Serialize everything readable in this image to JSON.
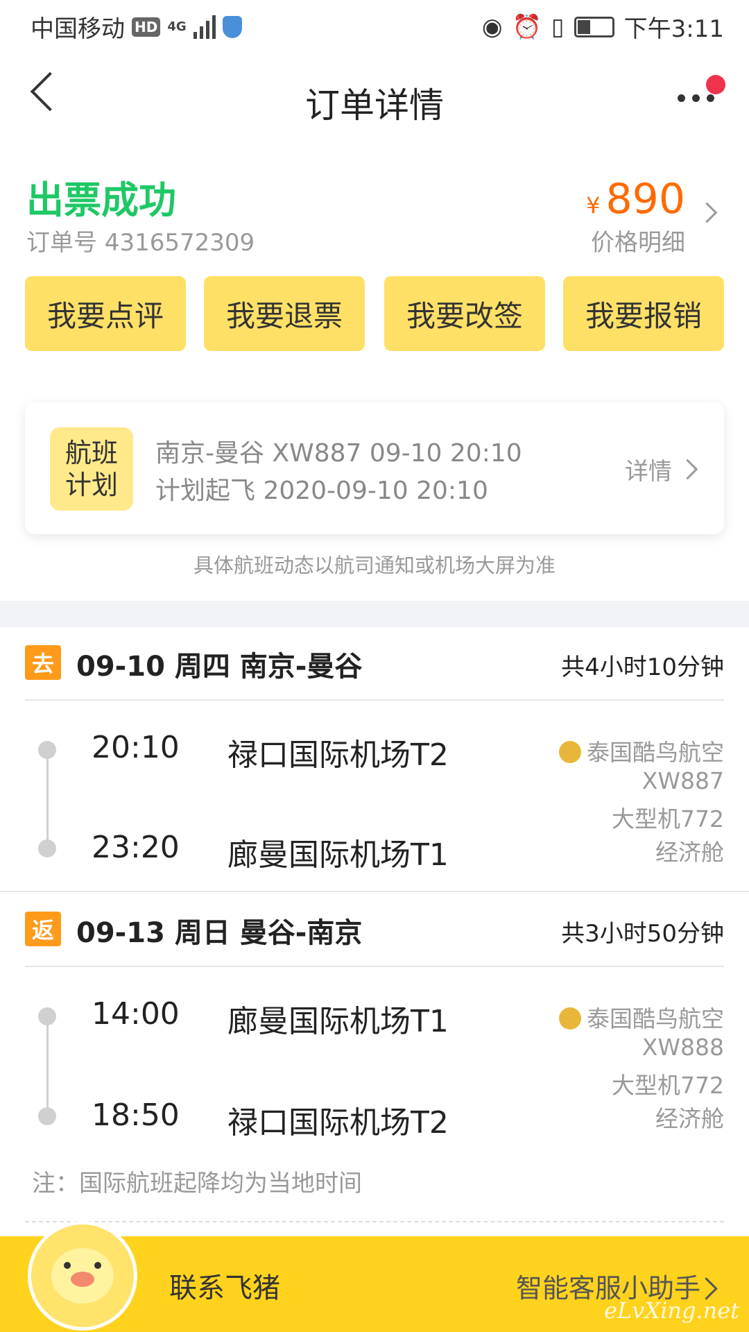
{
  "status_bar": {
    "carrier": "中国移动",
    "hd": "HD",
    "network": "4G",
    "time": "下午3:11"
  },
  "nav": {
    "title": "订单详情"
  },
  "order": {
    "status": "出票成功",
    "order_no": "订单号 4316572309",
    "currency": "¥",
    "price": "890",
    "price_detail": "价格明细"
  },
  "actions": [
    {
      "label": "我要点评"
    },
    {
      "label": "我要退票"
    },
    {
      "label": "我要改签"
    },
    {
      "label": "我要报销"
    }
  ],
  "flight_plan": {
    "badge_line1": "航班",
    "badge_line2": "计划",
    "line1": "南京-曼谷 XW887 09-10 20:10",
    "line2": "计划起飞 2020-09-10 20:10",
    "detail": "详情"
  },
  "notice": "具体航班动态以航司通知或机场大屏为准",
  "legs": [
    {
      "tag": "去",
      "title": "09-10 周四 南京-曼谷",
      "duration": "共4小时10分钟",
      "dep_time": "20:10",
      "dep_airport": "禄口国际机场T2",
      "arr_time": "23:20",
      "arr_airport": "廊曼国际机场T1",
      "airline": "泰国酷鸟航空",
      "flight_no": "XW887",
      "aircraft": "大型机772",
      "cabin": "经济舱"
    },
    {
      "tag": "返",
      "title": "09-13 周日 曼谷-南京",
      "duration": "共3小时50分钟",
      "dep_time": "14:00",
      "dep_airport": "廊曼国际机场T1",
      "arr_time": "18:50",
      "arr_airport": "禄口国际机场T2",
      "airline": "泰国酷鸟航空",
      "flight_no": "XW888",
      "aircraft": "大型机772",
      "cabin": "经济舱"
    }
  ],
  "note": "注：国际航班起降均为当地时间",
  "bottom": {
    "contact": "联系飞猪",
    "assistant": "智能客服小助手",
    "watermark": "eLvXing.net"
  },
  "colors": {
    "success": "#1ec865",
    "price": "#ff6a00",
    "button": "#ffe066",
    "tag": "#ff9a1a",
    "bottom_bar": "#ffd21e"
  },
  "icons": [
    "back-icon",
    "more-icon",
    "chevron-right-icon",
    "airline-logo-icon",
    "customer-service-avatar"
  ]
}
